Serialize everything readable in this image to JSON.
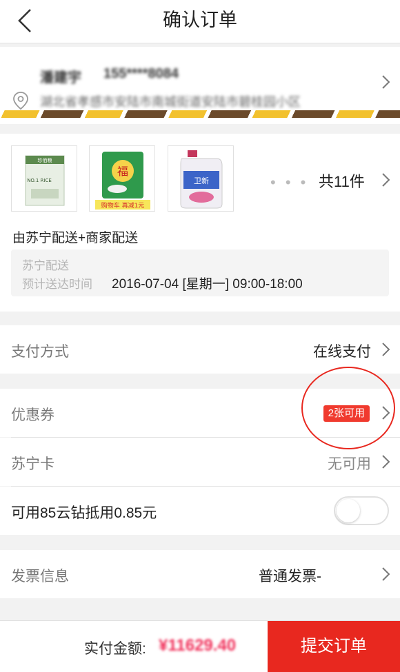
{
  "header": {
    "title": "确认订单"
  },
  "address": {
    "name": "潘建宇",
    "phone": "155****8084",
    "detail": "湖北省孝感市安陆市南城街道安陆市碧桂园小区"
  },
  "products": {
    "items": [
      {
        "name": "珍佰粮 NO.1 RICE 大米",
        "brand": "珍佰粮",
        "label": "NO.1 RICE"
      },
      {
        "name": "福临门 大米",
        "brand": "福",
        "promo": "购物车 再减1元"
      },
      {
        "name": "卫新 洗衣液",
        "brand": "卫新"
      }
    ],
    "more": "• • •",
    "count": "共11件",
    "delivery_by": "由苏宁配送+商家配送",
    "delivery_carrier": "苏宁配送",
    "delivery_eta_label": "预计送达时间",
    "delivery_eta_value": "2016-07-04 [星期一] 09:00-18:00"
  },
  "payment": {
    "label": "支付方式",
    "value": "在线支付"
  },
  "coupon": {
    "label": "优惠券",
    "badge": "2张可用"
  },
  "suning_card": {
    "label": "苏宁卡",
    "value": "无可用"
  },
  "cloud_diamond": {
    "label": "可用85云钻抵用0.85元",
    "enabled": false
  },
  "invoice": {
    "label": "发票信息",
    "value": "普通发票-"
  },
  "footer": {
    "amount_label": "实付金额:",
    "amount_value": "¥11629.40",
    "submit": "提交订单"
  },
  "colors": {
    "accent": "#e8281f",
    "price": "#f0305a"
  }
}
